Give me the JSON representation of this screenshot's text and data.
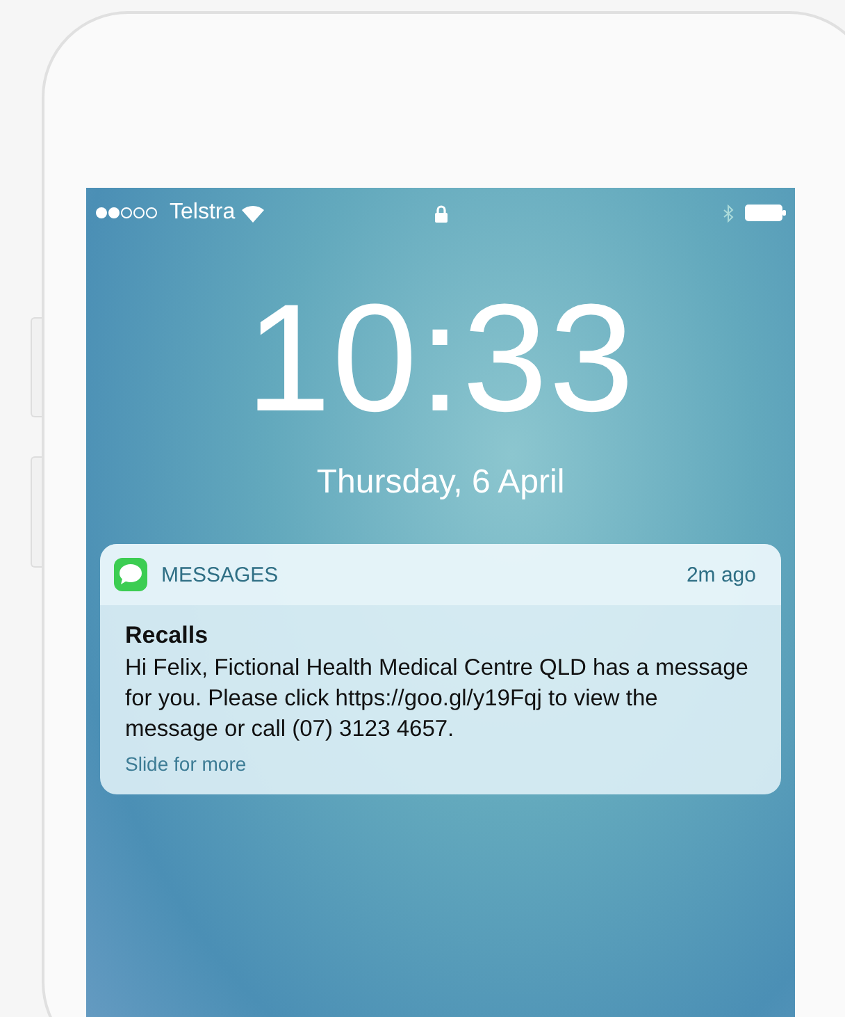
{
  "status_bar": {
    "carrier": "Telstra"
  },
  "lock_screen": {
    "time": "10:33",
    "date": "Thursday, 6 April"
  },
  "notification": {
    "app": "MESSAGES",
    "age": "2m ago",
    "title": "Recalls",
    "body": "Hi Felix, Fictional Health Medical Centre QLD has a message for you. Please click https://goo.gl/y19Fqj to view the message or call (07) 3123 4657.",
    "action": "Slide for more"
  }
}
